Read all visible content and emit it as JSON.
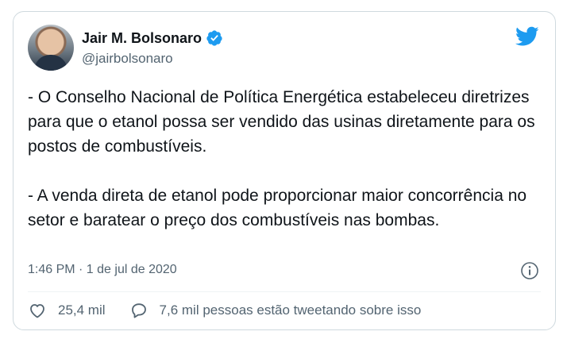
{
  "tweet": {
    "author_name": "Jair M. Bolsonaro",
    "handle": "@jairbolsonaro",
    "paragraphs": [
      "- O Conselho Nacional de Política Energética estabeleceu diretrizes para que o etanol possa ser vendido das usinas diretamente para os postos de combustíveis.",
      "- A venda direta de etanol pode proporcionar maior concorrência no setor e baratear o preço dos combustíveis nas bombas."
    ],
    "timestamp": "1:46 PM · 1 de jul de 2020",
    "likes": "25,4 mil",
    "tweeting_text": "7,6 mil pessoas estão tweetando sobre isso"
  },
  "icons": {
    "verified": "verified-badge-icon",
    "brand": "twitter-bird-icon",
    "info": "info-icon",
    "like": "heart-icon",
    "reply": "speech-bubble-icon"
  },
  "colors": {
    "twitter_blue": "#1d9bf0",
    "text": "#0f1419",
    "secondary": "#536471",
    "border": "#cfd9de"
  }
}
